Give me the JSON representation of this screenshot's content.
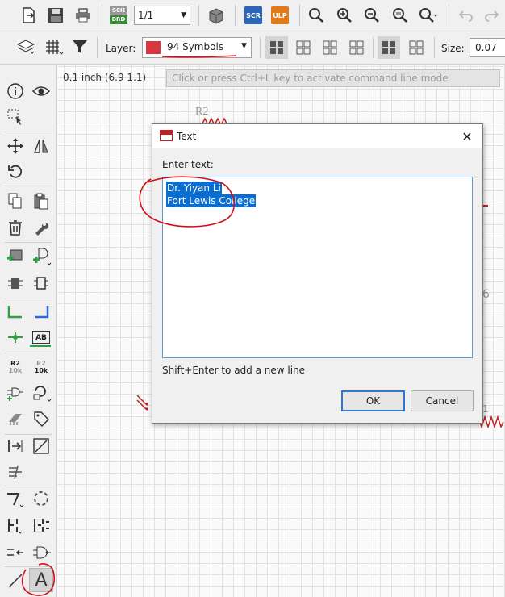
{
  "toolbar": {
    "sheet_value": "1/1",
    "badges": {
      "brd": "BRD",
      "scr": "SCR",
      "ulp": "ULP",
      "sch": "SCH"
    },
    "icons": [
      "file-open-icon",
      "save-icon",
      "print-icon",
      "sch-brd-switch-icon",
      "library-icon",
      "script-icon",
      "ulp-icon",
      "zoom-fit-icon",
      "zoom-in-icon",
      "zoom-out-icon",
      "zoom-redraw-icon",
      "zoom-select-icon",
      "undo-icon",
      "redo-icon"
    ]
  },
  "param_bar": {
    "layer_label": "Layer:",
    "layer_value": "94 Symbols",
    "layer_color": "#d9363e",
    "size_label": "Size:",
    "size_value": "0.07"
  },
  "status": {
    "grid_coord": "0.1 inch (6.9 1.1)",
    "command_placeholder": "Click or press Ctrl+L key to activate command line mode"
  },
  "canvas": {
    "part_label": "R2",
    "value_label": "6",
    "part_label_2": "1"
  },
  "palette": {
    "name_tool": {
      "top": "R2",
      "bottom": "10k"
    },
    "value_tool": {
      "top": "R2",
      "bottom": "10k"
    },
    "label_tool": "AB",
    "text_tool": "A"
  },
  "dialog": {
    "title": "Text",
    "label": "Enter text:",
    "lines": [
      "Dr. Yiyan Li",
      "Fort Lewis College"
    ],
    "hint": "Shift+Enter to add a new line",
    "ok": "OK",
    "cancel": "Cancel"
  },
  "colors": {
    "accent": "#0a6ed1",
    "annotation": "#d0101c",
    "net": "#2b6cd8",
    "wire": "#2f9e44"
  }
}
